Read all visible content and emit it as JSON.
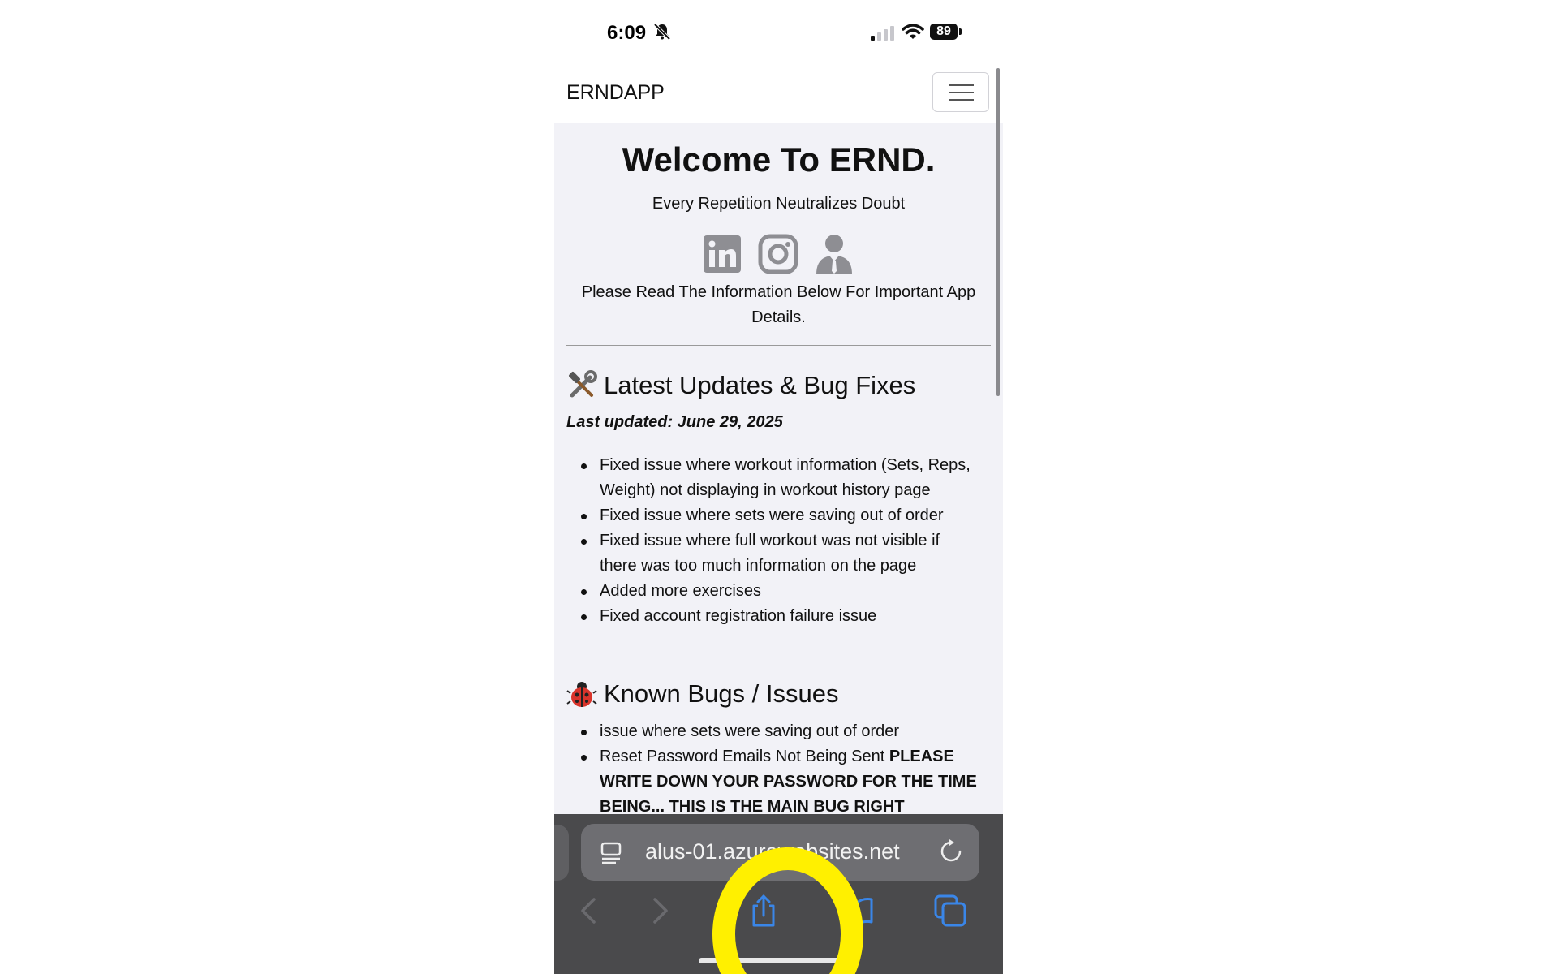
{
  "status_bar": {
    "time": "6:09",
    "battery": "89",
    "icons": [
      "bell-slash-icon",
      "cellular-signal-icon",
      "wifi-icon",
      "battery-icon"
    ]
  },
  "navbar": {
    "brand": "ERNDAPP",
    "menu_icon": "hamburger-icon"
  },
  "hero": {
    "title": "Welcome To ERND.",
    "subtitle": "Every Repetition Neutralizes Doubt",
    "social_icons": [
      "linkedin-icon",
      "instagram-icon",
      "person-icon"
    ],
    "intro": "Please Read The Information Below For Important App Details."
  },
  "updates": {
    "emoji": "hammer-and-wrench-icon",
    "heading": "Latest Updates & Bug Fixes",
    "last_updated": "Last updated: June 29, 2025",
    "items": [
      "Fixed issue where workout information (Sets, Reps, Weight) not displaying in workout history page",
      "Fixed issue where sets were saving out of order",
      "Fixed issue where full workout was not visible if there was too much information on the page",
      "Added more exercises",
      "Fixed account registration failure issue"
    ]
  },
  "bugs": {
    "emoji": "ladybug-icon",
    "heading": "Known Bugs / Issues",
    "items": [
      {
        "text": "issue where sets were saving out of order",
        "bold": ""
      },
      {
        "text": "Reset Password Emails Not Being Sent ",
        "bold": "PLEASE WRITE DOWN YOUR PASSWORD FOR THE TIME BEING... THIS IS THE MAIN BUG RIGHT"
      }
    ]
  },
  "safari": {
    "url": "alus-01.azurewebsites.net",
    "toolbar_icons": [
      "back-icon",
      "forward-icon",
      "share-icon",
      "bookmarks-icon",
      "tabs-icon"
    ]
  },
  "colors": {
    "accent_blue": "#3a86e8",
    "highlight": "#fff000",
    "content_bg": "#f2f2f7",
    "toolbar_bg": "#4a4a4c"
  }
}
